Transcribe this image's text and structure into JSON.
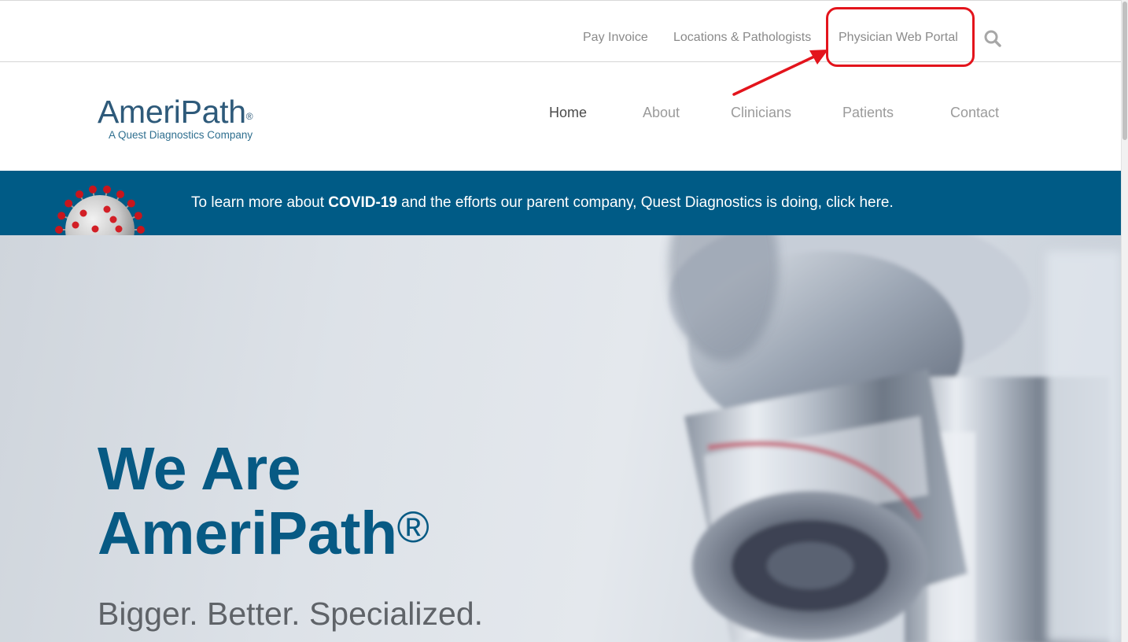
{
  "utility_nav": {
    "pay_invoice": "Pay Invoice",
    "locations": "Locations & Pathologists",
    "physician_portal": "Physician Web Portal",
    "search_icon": "search-icon"
  },
  "logo": {
    "name": "AmeriPath",
    "registered": "®",
    "subtitle": "A Quest Diagnostics Company"
  },
  "main_nav": {
    "items": [
      "Home",
      "About",
      "Clinicians",
      "Patients",
      "Contact"
    ],
    "active": "Home"
  },
  "covid_banner": {
    "text_before": "To learn more about ",
    "text_bold": "COVID-19",
    "text_after": " and the efforts our parent company, Quest Diagnostics is doing, click here.",
    "icon": "coronavirus-icon"
  },
  "hero": {
    "title_line1": "We Are",
    "title_line2": "AmeriPath",
    "registered": "®",
    "tagline": "Bigger. Better. Specialized."
  },
  "annotation": {
    "highlight_color": "#e3141c",
    "target": "physician_portal"
  },
  "colors": {
    "brand_blue": "#005b86",
    "hero_title": "#075a84",
    "logo_text": "#2e5a7a",
    "nav_active": "#4a4a4a",
    "nav_inactive": "#9b9b9b"
  }
}
